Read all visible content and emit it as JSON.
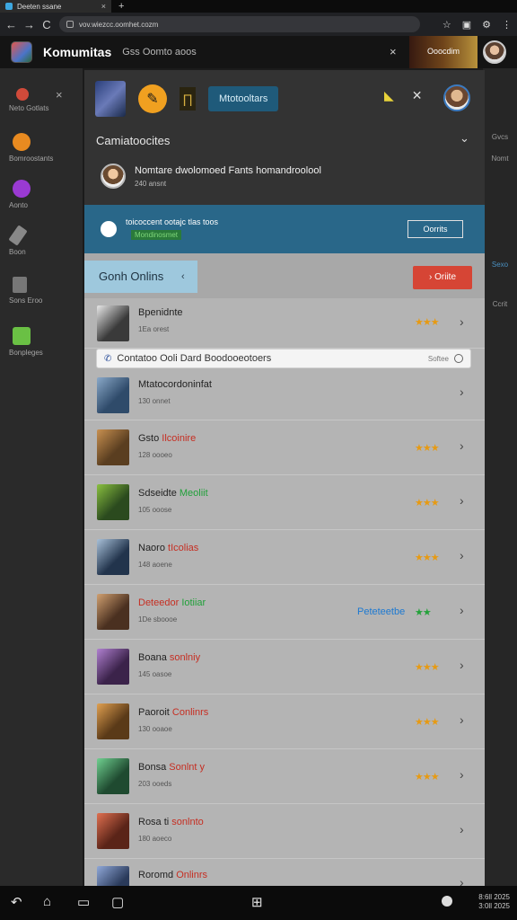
{
  "browser": {
    "tab_title": "Deeten ssane",
    "tab_close": "×",
    "new_tab": "+",
    "back": "←",
    "forward": "→",
    "reload": "C",
    "url": "vov.wiezcc.oomhet.cozm",
    "icons": [
      "star-icon",
      "translate-icon",
      "settings-icon",
      "menu-icon"
    ]
  },
  "app": {
    "title": "Komumitas",
    "subtitle": "Gss Oomto aoos",
    "close": "×",
    "banner_text": "Ooocdim"
  },
  "sidebar": {
    "close": "×",
    "items": [
      {
        "label": "Neto Gotlats",
        "color": "#d04a3a",
        "icon": "heart-icon"
      },
      {
        "label": "Bomroostants",
        "color": "#e88a20",
        "icon": "cross-icon"
      },
      {
        "label": "Aonto",
        "color": "#9a3ad2",
        "icon": "q-icon"
      },
      {
        "label": "Boon",
        "color": "#888888",
        "icon": "tool-icon"
      },
      {
        "label": "Sons Eroo",
        "color": "#777777",
        "icon": "folder-icon"
      },
      {
        "label": "Bonpleges",
        "color": "#6ac044",
        "icon": "image-icon"
      }
    ]
  },
  "right_peek": {
    "lines": [
      "Gvcs",
      "Nomt",
      "Sexo",
      "Ccrit"
    ]
  },
  "panel": {
    "chip_label": "Mtotooltars",
    "section_title": "Camiatoocites",
    "section_chevron": "⌄",
    "notification": {
      "title": "Nomtare dwolomoed Fants homandroolool",
      "meta": "240 ansnt"
    },
    "banner": {
      "text": "toicoccent ootajc tlas toos",
      "tag": "Mondinosmet",
      "button": "Oorrits"
    },
    "filter": {
      "tab_label": "Gonh Onlins",
      "tab_chevron": "‹",
      "button_label": "› Oriite"
    },
    "search": {
      "text": "Contatoo Ooli Dard Boodooeotoers",
      "right": "Softee"
    },
    "rows": [
      {
        "title_a": "Bpenidnte",
        "title_b": "",
        "hl": "",
        "meta": "1Ea orest",
        "rating": "★★★",
        "status": "",
        "thumb": "#3a3a3a"
      },
      {
        "title_a": "Mtatocordoninfat",
        "title_b": "",
        "hl": "",
        "meta": "130 onnet",
        "rating": "",
        "status": "",
        "thumb": "#2f4b6a"
      },
      {
        "title_a": "Gsto ",
        "title_b": "Ilcoinire",
        "hl": "red",
        "meta": "128 oooeo",
        "rating": "★★★",
        "status": "",
        "thumb": "#5a3e20"
      },
      {
        "title_a": "Sdseidte ",
        "title_b": "Meoliit",
        "hl": "green",
        "meta": "105 ooose",
        "rating": "★★★",
        "status": "",
        "thumb": "#2b4a1e"
      },
      {
        "title_a": "Naoro ",
        "title_b": "tIcolias",
        "hl": "red",
        "meta": "148 aoene",
        "rating": "★★★",
        "status": "",
        "thumb": "#22344c"
      },
      {
        "title_a": "Deteedor ",
        "title_b": "Iotiiar",
        "hl": "green",
        "meta": "1De sboooe",
        "rating": "★★",
        "status": "Peteteetbe",
        "thumb": "#4a3020"
      },
      {
        "title_a": "Boana ",
        "title_b": "sonlniy",
        "hl": "red",
        "meta": "145 oasoe",
        "rating": "★★★",
        "status": "",
        "thumb": "#3b234a"
      },
      {
        "title_a": "Paoroit ",
        "title_b": "Conlinrs",
        "hl": "red",
        "meta": "130 ooaoe",
        "rating": "★★★",
        "status": "",
        "thumb": "#5a3a18"
      },
      {
        "title_a": "Bonsa ",
        "title_b": "Sonlnt y",
        "hl": "red",
        "meta": "203 ooeds",
        "rating": "★★★",
        "status": "",
        "thumb": "#1f4a30"
      },
      {
        "title_a": "Rosa ti ",
        "title_b": "sonlnto",
        "hl": "red",
        "meta": "180 aoeco",
        "rating": "",
        "status": "",
        "thumb": "#5a2418"
      },
      {
        "title_a": "Roromd ",
        "title_b": "Onlinrs",
        "hl": "red",
        "meta": "",
        "rating": "",
        "status": "",
        "thumb": "#2a3a5a"
      }
    ]
  },
  "bottom": {
    "icons": [
      "undo-icon",
      "home-icon",
      "recent-icon",
      "square-icon",
      "grid-icon"
    ],
    "clock_line1": "8:6ll 2025",
    "clock_line2": "3:0ll 2025"
  }
}
